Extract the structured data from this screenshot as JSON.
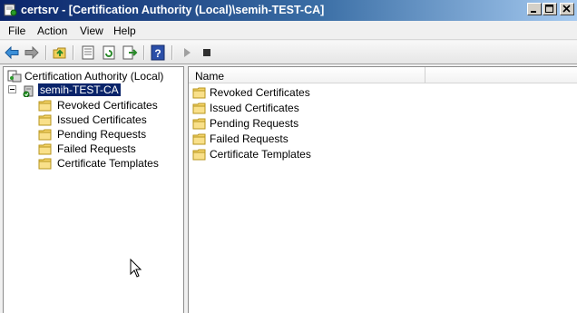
{
  "window": {
    "title": "certsrv - [Certification Authority (Local)\\semih-TEST-CA]"
  },
  "menu": [
    "File",
    "Action",
    "View",
    "Help"
  ],
  "toolbar": {
    "buttons": [
      "back-icon",
      "forward-icon",
      "up-one-level-icon",
      "properties-icon",
      "refresh-icon",
      "export-list-icon",
      "help-icon",
      "start-service-icon",
      "stop-service-icon"
    ]
  },
  "tree": {
    "root": "Certification Authority (Local)",
    "ca": "semih-TEST-CA",
    "children": [
      "Revoked Certificates",
      "Issued Certificates",
      "Pending Requests",
      "Failed Requests",
      "Certificate Templates"
    ]
  },
  "list": {
    "column": "Name",
    "items": [
      "Revoked Certificates",
      "Issued Certificates",
      "Pending Requests",
      "Failed Requests",
      "Certificate Templates"
    ]
  },
  "colors": {
    "titlebar_start": "#0a246a",
    "titlebar_end": "#a6caf0",
    "selection": "#0a246a",
    "folder": "#f5d46a"
  }
}
